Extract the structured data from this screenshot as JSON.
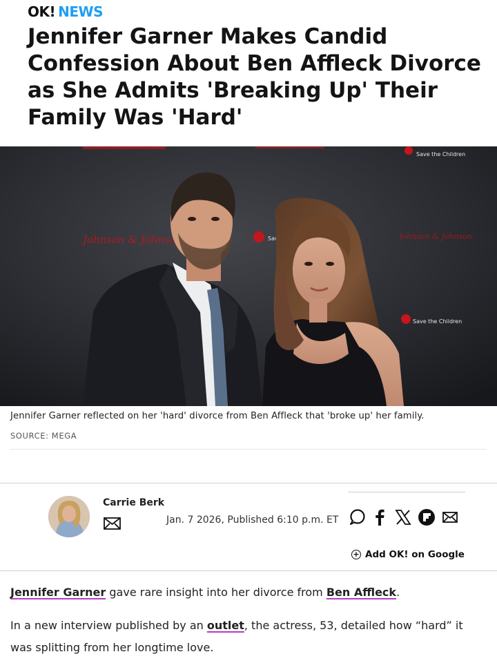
{
  "brand": {
    "ok": "OK!",
    "news": "NEWS"
  },
  "article": {
    "headline": "Jennifer Garner Makes Candid Confession About Ben Affleck Divorce as She Admits 'Breaking Up' Their Family Was 'Hard'",
    "image_caption": "Jennifer Garner reflected on her 'hard' divorce from Ben Affleck that 'broke up' her family.",
    "image_source": "SOURCE: MEGA",
    "author": "Carrie Berk",
    "dateline": "Jan. 7 2026, Published 6:10 p.m. ET",
    "add_google": "Add OK! on Google",
    "p1": {
      "link1": "Jennifer Garner",
      "mid": " gave rare insight into her divorce from ",
      "link2": "Ben Affleck",
      "end": "."
    },
    "p2": {
      "start": "In a new interview published by an ",
      "link": "outlet",
      "end": ", the actress, 53, detailed how “hard” it was splitting from her longtime love."
    }
  },
  "photo_backdrop": {
    "logo1": "Johnson & Johnson",
    "logo2": "Save the Children",
    "logo3": "Save",
    "top_partial": "Save the Children"
  },
  "icons": [
    "mail-icon",
    "comment-icon",
    "facebook-icon",
    "x-icon",
    "flipboard-icon",
    "mail-icon",
    "plus-circle-icon"
  ],
  "colors": {
    "brand_blue": "#1e9ff2",
    "link_underline": "#b53cc0",
    "logo_red": "#c4161c"
  }
}
